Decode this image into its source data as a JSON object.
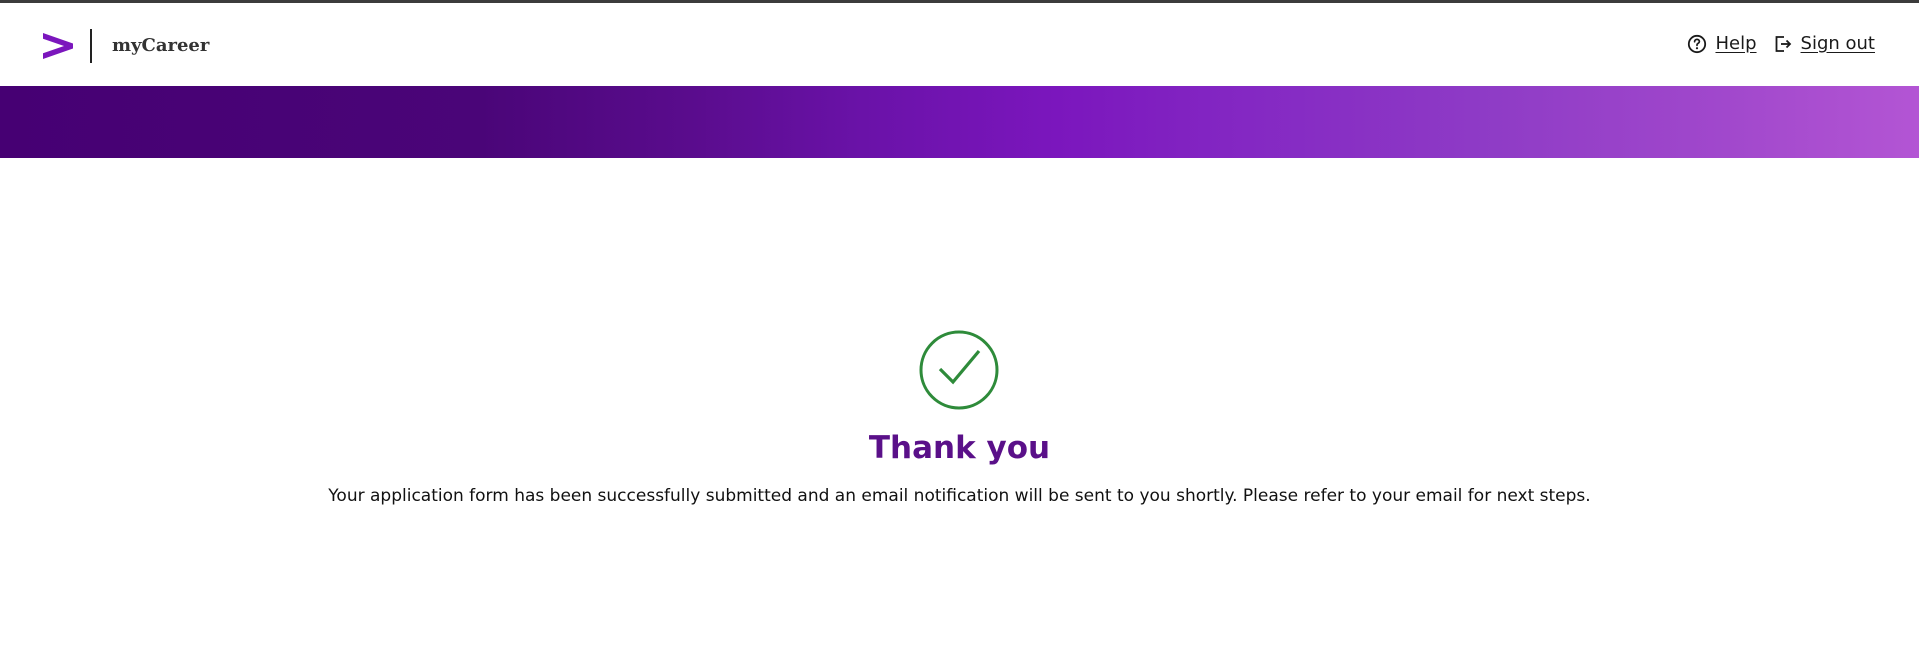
{
  "header": {
    "app_name": "myCareer",
    "logo_icon": "accenture-greater-than-logo",
    "nav": {
      "help_label": "Help",
      "help_icon": "question-circle-icon",
      "signout_label": "Sign out",
      "signout_icon": "exit-door-icon"
    }
  },
  "banner": {
    "gradient_start": "#460073",
    "gradient_mid": "#7b16bd",
    "gradient_end": "#b355d4"
  },
  "confirmation": {
    "icon": "check-circle-icon",
    "icon_color": "#2e8b3a",
    "title": "Thank you",
    "title_color": "#5a1089",
    "message": "Your application form has been successfully submitted and an email notification will be sent to you shortly. Please refer to your email for next steps."
  },
  "colors": {
    "brand_purple": "#7b16bd",
    "text": "#111111"
  }
}
